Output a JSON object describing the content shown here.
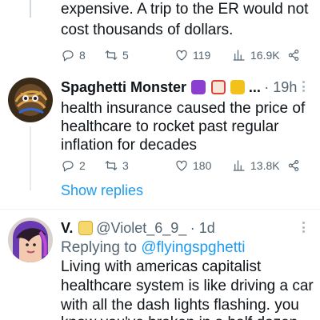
{
  "tweet_prev": {
    "text_line1": "expensive. A trip to the ER would not",
    "text_line2": "cost thousands of dollars.",
    "replies": "8",
    "retweets": "5",
    "likes": "119",
    "views": "16.9K"
  },
  "tweet_main": {
    "display_name": "Spaghetti Monster",
    "name_suffix": "...",
    "time": "· 19h",
    "text_line1": "health insurance caused the price of",
    "text_line2": "healthcare to rocket past regular",
    "text_line3": "inflation for decades",
    "replies": "2",
    "retweets": "3",
    "likes": "180",
    "views": "13.8K",
    "show_replies": "Show replies"
  },
  "tweet_next": {
    "display_name": "V.",
    "handle": "@Violet_6_9_",
    "time": "· 1d",
    "replying_prefix": "Replying to",
    "replying_handle": "@flyingspghetti",
    "text_line1": "Living with americas capitalist",
    "text_line2": "healthcare system is like driving a car",
    "text_line3": "with all the dash lights flashing. you",
    "text_line4": "know you've broken in a half dozen"
  },
  "colors": {
    "link": "#1d9bf0",
    "secondary": "#536471",
    "divider": "#eff3f4"
  },
  "icons": [
    "reply-icon",
    "retweet-icon",
    "like-icon",
    "views-icon",
    "share-icon",
    "more-icon"
  ]
}
